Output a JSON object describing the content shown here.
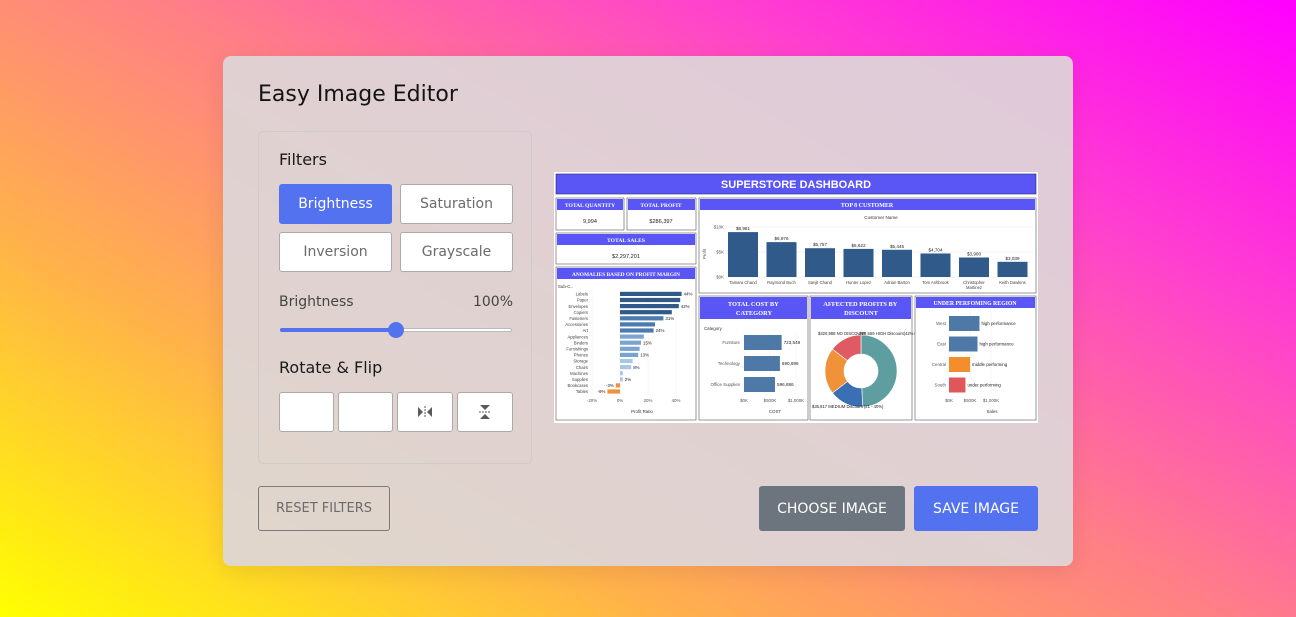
{
  "app": {
    "title": "Easy Image Editor"
  },
  "filters": {
    "title": "Filters",
    "buttons": [
      "Brightness",
      "Saturation",
      "Inversion",
      "Grayscale"
    ],
    "active": "Brightness"
  },
  "slider": {
    "name": "Brightness",
    "value_label": "100%",
    "value_fraction": 0.5
  },
  "rotate": {
    "title": "Rotate & Flip",
    "icons": [
      "rotate-left-icon",
      "rotate-right-icon",
      "flip-horizontal-icon",
      "flip-vertical-icon"
    ]
  },
  "actions": {
    "reset": "RESET FILTERS",
    "choose": "CHOOSE IMAGE",
    "save": "SAVE IMAGE"
  },
  "colors": {
    "accent": "#5372f0",
    "secondary": "#6c757d",
    "dash_header": "#5a55f5",
    "dash_bar": "#2f5a8a"
  },
  "dashboard": {
    "title": "SUPERSTORE DASHBOARD",
    "kpis": [
      {
        "label": "TOTAL QUANTITY",
        "value": "9,994"
      },
      {
        "label": "TOTAL PROFIT",
        "value": "$286,397"
      },
      {
        "label": "TOTAL SALES",
        "value": "$2,297,201"
      }
    ],
    "top_customer": {
      "title": "TOP 8 CUSTOMER",
      "subtitle": "Customer Name",
      "y_label": "Profit",
      "y_ticks": [
        "$10K",
        "$5K",
        "$0K"
      ],
      "customers": [
        "Tamara Chand",
        "Raymond Buch",
        "Sanjit Chand",
        "Hunter Lopez",
        "Adrian Barton",
        "Tom Ashbrook",
        "Christopher Martinez",
        "Keith Dawkins"
      ],
      "value_labels": [
        "$8,981",
        "$6,976",
        "$5,757",
        "$5,622",
        "$5,445",
        "$4,704",
        "$3,900",
        "$3,039"
      ],
      "values": [
        8981,
        6976,
        5757,
        5622,
        5445,
        4704,
        3900,
        3039
      ]
    },
    "anomalies": {
      "title": "ANOMALIES BASED ON PROFIT MARGIN",
      "axis_header": "Sub-C..",
      "categories": [
        "Labels",
        "Paper",
        "Envelopes",
        "Copiers",
        "Fasteners",
        "Accessories",
        "Art",
        "Appliances",
        "Binders",
        "Furnishings",
        "Phones",
        "Storage",
        "Chairs",
        "Machines",
        "Supplies",
        "Bookcases",
        "Tables"
      ],
      "values": [
        44,
        43,
        42,
        37,
        31,
        25,
        24,
        17,
        15,
        14,
        13,
        9,
        8,
        2,
        2,
        -3,
        -9
      ],
      "value_labels": [
        "44%",
        "",
        "42%",
        "",
        "31%",
        "",
        "24%",
        "",
        "15%",
        "",
        "13%",
        "",
        "8%",
        "",
        "2%",
        "-3%",
        "-9%"
      ],
      "x_ticks": [
        "-20%",
        "0%",
        "20%",
        "40%"
      ],
      "x_label": "Profit Ratio"
    },
    "cost_by_category": {
      "title": "TOTAL COST BY CATEGORY",
      "axis_header": "Category",
      "categories": [
        "Furniture",
        "Technology",
        "Office Supplies"
      ],
      "values": [
        723549,
        690695,
        596886
      ],
      "value_labels": [
        "723,549",
        "690,695",
        "596,886"
      ],
      "x_ticks": [
        "$0K",
        "$500K",
        "$1,000K"
      ],
      "x_label": "COST"
    },
    "affected_profits": {
      "title": "AFFECTED PROFITS BY DISCOUNT",
      "labels": [
        "$320,988 NO DISCOUNT",
        "-$99,559 HIGH Discount(42%+)",
        "$35,817 MEDIUM Discount (21 - 40%)"
      ],
      "slices": [
        {
          "value": 320988,
          "color": "#5f9ea0"
        },
        {
          "value": 99559,
          "color": "#3b6fb5"
        },
        {
          "value": 135817,
          "color": "#f0923a"
        },
        {
          "value": 95000,
          "color": "#e05a63"
        }
      ]
    },
    "underperforming": {
      "title": "UNDER PERFOMING REGION",
      "categories": [
        "West",
        "East",
        "Central",
        "South"
      ],
      "values": [
        725458,
        678781,
        501240,
        391722
      ],
      "labels": [
        "high performance",
        "high performance",
        "middle performing",
        "under performing"
      ],
      "colors": [
        "#4e79a7",
        "#4e79a7",
        "#f28e2b",
        "#e15759"
      ],
      "x_ticks": [
        "$0K",
        "$500K",
        "$1,000K"
      ],
      "x_label": "Sales"
    }
  }
}
